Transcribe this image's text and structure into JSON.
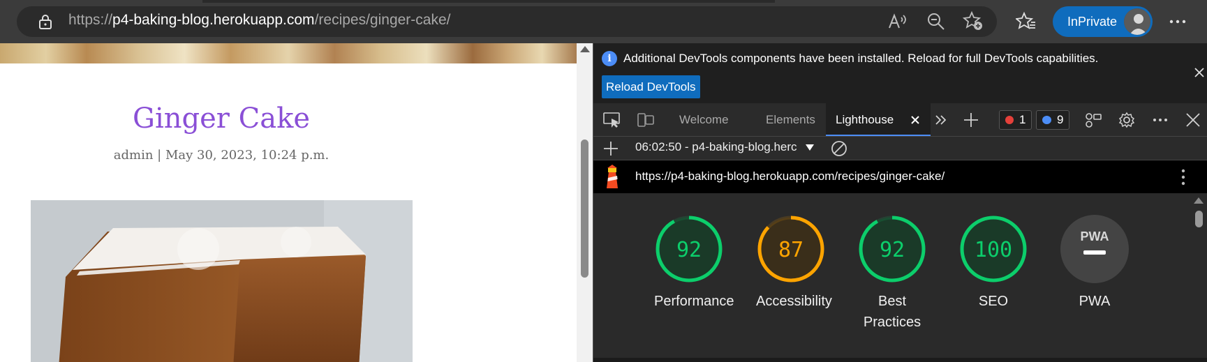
{
  "browser": {
    "url_prefix": "https://",
    "url_host": "p4-baking-blog.herokuapp.com",
    "url_path": "/recipes/ginger-cake/",
    "inprivate_label": "InPrivate",
    "icons": [
      "lock-icon",
      "read-aloud-icon",
      "zoom-out-icon",
      "add-favorite-icon",
      "favorites-icon",
      "more-icon"
    ]
  },
  "page": {
    "title": "Ginger Cake",
    "meta": "admin | May 30, 2023, 10:24 p.m."
  },
  "devtools": {
    "info_message": "Additional DevTools components have been installed. Reload for full DevTools capabilities.",
    "reload_button": "Reload DevTools",
    "tabs": {
      "welcome": "Welcome",
      "elements": "Elements",
      "lighthouse": "Lighthouse"
    },
    "error_count": "1",
    "message_count": "9",
    "report_select": "06:02:50 - p4-baking-blog.herc",
    "report_url": "https://p4-baking-blog.herokuapp.com/recipes/ginger-cake/",
    "scores": [
      {
        "label": "Performance",
        "score": "92",
        "value": 92,
        "color": "#0cce6b"
      },
      {
        "label": "Accessibility",
        "score": "87",
        "value": 87,
        "color": "#ffa400"
      },
      {
        "label": "Best Practices",
        "score": "92",
        "value": 92,
        "color": "#0cce6b"
      },
      {
        "label": "SEO",
        "score": "100",
        "value": 100,
        "color": "#0cce6b"
      },
      {
        "label": "PWA",
        "score": "",
        "value": null,
        "color": "#777777"
      }
    ],
    "pwa_badge_text": "PWA"
  }
}
